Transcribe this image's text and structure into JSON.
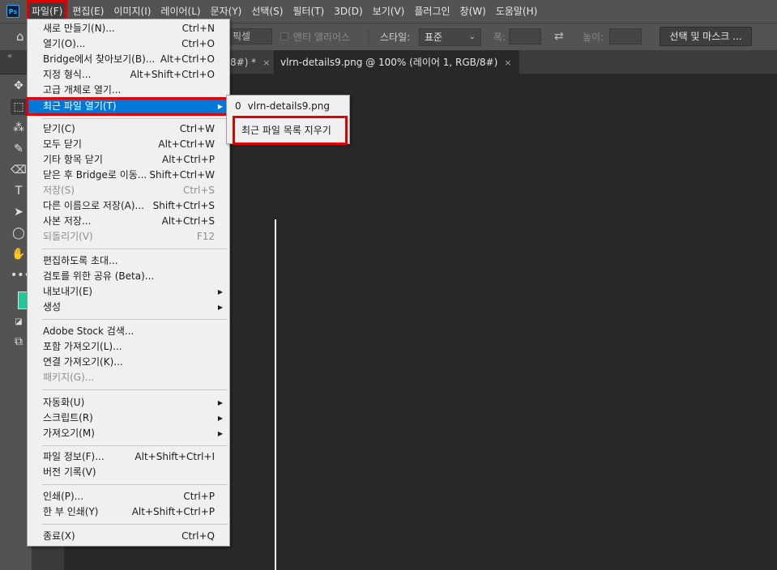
{
  "app": {
    "logo_text": "Ps"
  },
  "menubar": {
    "items": [
      "파일(F)",
      "편집(E)",
      "이미지(I)",
      "레이어(L)",
      "문자(Y)",
      "선택(S)",
      "필터(T)",
      "3D(D)",
      "보기(V)",
      "플러그인",
      "창(W)",
      "도움말(H)"
    ]
  },
  "options_bar": {
    "feather_value": "픽셀",
    "antialias_label": "앤티 앨리어스",
    "style_label": "스타일:",
    "style_value": "표준",
    "width_label": "폭:",
    "height_label": "높이:",
    "select_mask_label": "선택 및 마스크 ..."
  },
  "tabs": {
    "collapse_icon": "«",
    "inactive_tab": "8#) *",
    "active_tab": "vlrn-details9.png @ 100% (레이어 1, RGB/8#)",
    "close_glyph": "×"
  },
  "file_menu": {
    "items": [
      {
        "label": "새로 만들기(N)...",
        "shortcut": "Ctrl+N"
      },
      {
        "label": "열기(O)...",
        "shortcut": "Ctrl+O"
      },
      {
        "label": "Bridge에서 찾아보기(B)...",
        "shortcut": "Alt+Ctrl+O"
      },
      {
        "label": "지정 형식...",
        "shortcut": "Alt+Shift+Ctrl+O"
      },
      {
        "label": "고급 개체로 열기...",
        "shortcut": ""
      },
      {
        "label": "최근 파일 열기(T)",
        "shortcut": ""
      },
      {
        "label": "닫기(C)",
        "shortcut": "Ctrl+W"
      },
      {
        "label": "모두 닫기",
        "shortcut": "Alt+Ctrl+W"
      },
      {
        "label": "기타 항목 닫기",
        "shortcut": "Alt+Ctrl+P"
      },
      {
        "label": "닫은 후 Bridge로 이동...",
        "shortcut": "Shift+Ctrl+W"
      },
      {
        "label": "저장(S)",
        "shortcut": "Ctrl+S"
      },
      {
        "label": "다른 이름으로 저장(A)...",
        "shortcut": "Shift+Ctrl+S"
      },
      {
        "label": "사본 저장...",
        "shortcut": "Alt+Ctrl+S"
      },
      {
        "label": "되돌리기(V)",
        "shortcut": "F12"
      },
      {
        "label": "편집하도록 초대...",
        "shortcut": ""
      },
      {
        "label": "검토를 위한 공유 (Beta)...",
        "shortcut": ""
      },
      {
        "label": "내보내기(E)",
        "shortcut": ""
      },
      {
        "label": "생성",
        "shortcut": ""
      },
      {
        "label": "Adobe Stock 검색...",
        "shortcut": ""
      },
      {
        "label": "포함 가져오기(L)...",
        "shortcut": ""
      },
      {
        "label": "연결 가져오기(K)...",
        "shortcut": ""
      },
      {
        "label": "패키지(G)...",
        "shortcut": ""
      },
      {
        "label": "자동화(U)",
        "shortcut": ""
      },
      {
        "label": "스크립트(R)",
        "shortcut": ""
      },
      {
        "label": "가져오기(M)",
        "shortcut": ""
      },
      {
        "label": "파일 정보(F)...",
        "shortcut": "Alt+Shift+Ctrl+I"
      },
      {
        "label": "버전 기록(V)",
        "shortcut": ""
      },
      {
        "label": "인쇄(P)...",
        "shortcut": "Ctrl+P"
      },
      {
        "label": "한 부 인쇄(Y)",
        "shortcut": "Alt+Shift+Ctrl+P"
      },
      {
        "label": "종료(X)",
        "shortcut": "Ctrl+Q"
      }
    ],
    "submenu_arrow": "▶"
  },
  "recent_submenu": {
    "file_index": "0",
    "file_name": "vlrn-details9.png",
    "clear_label": "최근 파일 목록 지우기"
  }
}
